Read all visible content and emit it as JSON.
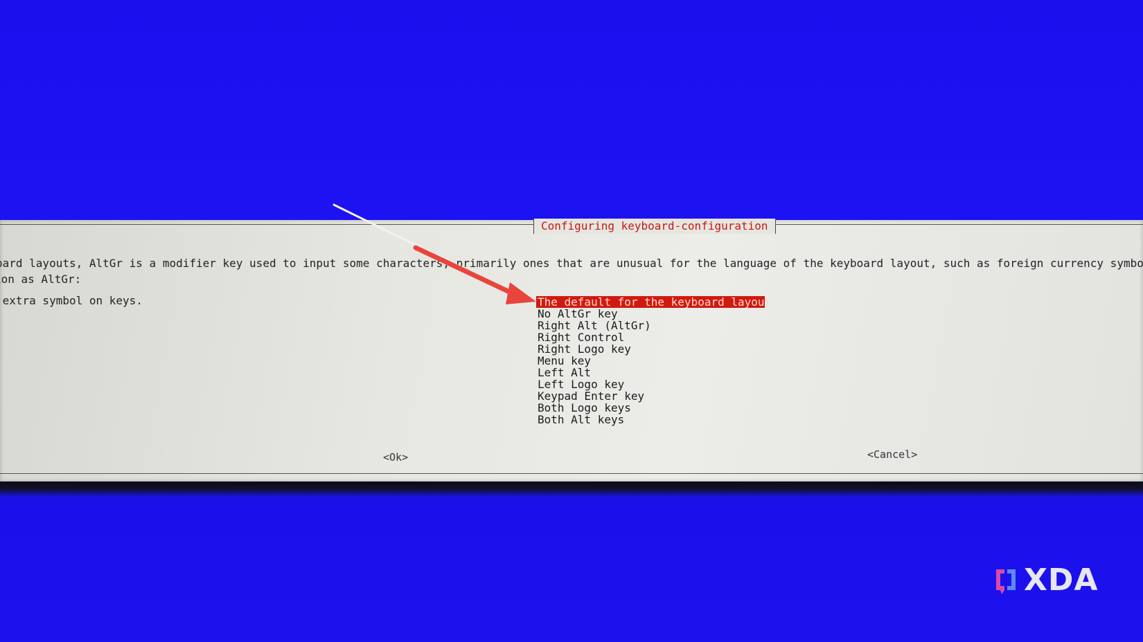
{
  "dialog": {
    "title": "Configuring keyboard-configuration",
    "description_lines": [
      "oard layouts, AltGr is a modifier key used to input some characters, primarily ones that are unusual for the language of the keyboard layout, such as foreign currency symbols a",
      " extra symbol on keys."
    ],
    "question": "ion as AltGr:",
    "options": [
      "The default for the keyboard layout",
      "No AltGr key",
      "Right Alt (AltGr)",
      "Right Control",
      "Right Logo key",
      "Menu key",
      "Left Alt",
      "Left Logo key",
      "Keypad Enter key",
      "Both Logo keys",
      "Both Alt keys"
    ],
    "selected_index": 0,
    "ok_label": "<Ok>",
    "cancel_label": "<Cancel>"
  },
  "watermark": {
    "brand": "XDA"
  },
  "colors": {
    "background_blue": "#1a10ee",
    "dialog_gray": "#e6e6e1",
    "selection_red": "#d01a10",
    "title_red": "#c41a12",
    "annotation_arrow": "#e8453c"
  },
  "icons": {
    "logo": "xda-logo-icon",
    "annotation": "arrow-pointer-icon"
  }
}
